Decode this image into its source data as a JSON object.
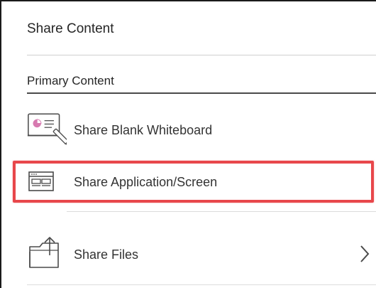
{
  "panel": {
    "title": "Share Content",
    "section_title": "Primary Content"
  },
  "items": [
    {
      "label": "Share Blank Whiteboard",
      "icon": "whiteboard-pen-icon"
    },
    {
      "label": "Share Application/Screen",
      "icon": "application-window-icon",
      "highlighted": true
    },
    {
      "label": "Share Files",
      "icon": "folder-upload-icon",
      "has_submenu": true
    }
  ],
  "colors": {
    "highlight_border": "#e8474b",
    "icon_accent_pink": "#d77ab0",
    "icon_stroke": "#4a4a4a",
    "text": "#262626"
  }
}
